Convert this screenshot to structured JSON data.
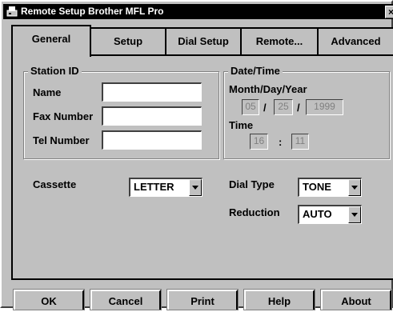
{
  "window": {
    "title": "Remote Setup Brother MFL Pro",
    "close_glyph": "×"
  },
  "tabs": [
    {
      "label": "General",
      "active": true
    },
    {
      "label": "Setup",
      "active": false
    },
    {
      "label": "Dial Setup",
      "active": false
    },
    {
      "label": "Remote...",
      "active": false
    },
    {
      "label": "Advanced",
      "active": false
    }
  ],
  "station_id": {
    "title": "Station ID",
    "name_label": "Name",
    "name_value": "",
    "fax_label": "Fax Number",
    "fax_value": "",
    "tel_label": "Tel Number",
    "tel_value": ""
  },
  "datetime": {
    "title": "Date/Time",
    "date_label": "Month/Day/Year",
    "month": "05",
    "day": "25",
    "year": "1999",
    "separator": "/",
    "time_label": "Time",
    "hour": "16",
    "minute": "11",
    "time_separator": ":"
  },
  "settings": {
    "cassette_label": "Cassette",
    "cassette_value": "LETTER",
    "dial_type_label": "Dial Type",
    "dial_type_value": "TONE",
    "reduction_label": "Reduction",
    "reduction_value": "AUTO"
  },
  "buttons": {
    "ok": "OK",
    "cancel": "Cancel",
    "print": "Print",
    "help": "Help",
    "about": "About"
  },
  "icons": {
    "app": "printer-fax-icon",
    "dropdown": "chevron-down-icon"
  },
  "colors": {
    "title_bar": "#000000",
    "face": "#c0c0c0",
    "disabled_text": "#808080"
  }
}
